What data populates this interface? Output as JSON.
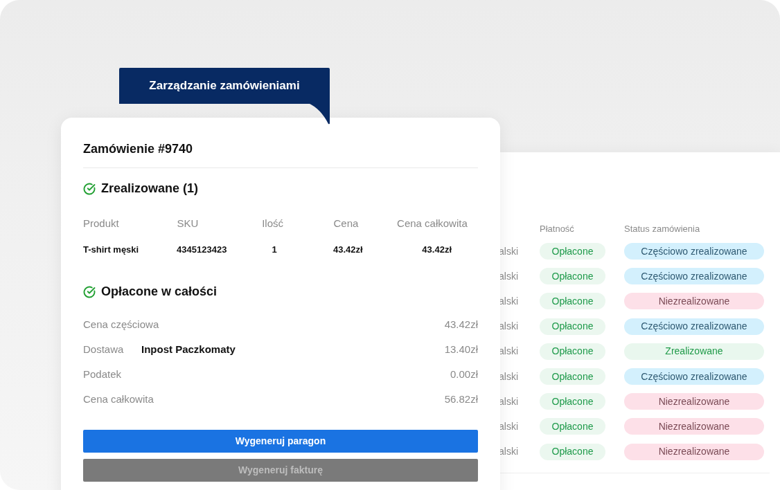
{
  "banner": {
    "title": "Zarządzanie zamówieniami"
  },
  "order": {
    "title": "Zamówienie #9740",
    "fulfilled_heading": "Zrealizowane (1)",
    "items": {
      "columns": [
        "Produkt",
        "SKU",
        "Ilość",
        "Cena",
        "Cena całkowita"
      ],
      "rows": [
        {
          "cells": [
            "T-shirt męski",
            "4345123423",
            "1",
            "43.42zł",
            "43.42zł"
          ]
        }
      ]
    },
    "payment_heading": "Opłacone w całości",
    "summary": [
      {
        "label": "Cena częściowa",
        "value": "43.42zł"
      },
      {
        "label": "Dostawa",
        "detail": "Inpost Paczkomaty",
        "value": "13.40zł"
      },
      {
        "label": "Podatek",
        "value": "0.00zł"
      },
      {
        "label": "Cena całkowita",
        "value": "56.82zł"
      }
    ],
    "buttons": [
      {
        "label": "Wygeneruj paragon",
        "disabled": false
      },
      {
        "label": "Wygeneruj fakturę",
        "disabled": true
      }
    ]
  },
  "orders_table": {
    "columns": [
      "Płatność",
      "Status zamówienia"
    ],
    "rows": [
      {
        "column_1": "alski",
        "payment": "Opłacone",
        "status": {
          "label": "Częściowo zrealizowane",
          "kind": "partial"
        }
      },
      {
        "column_1": "alski",
        "payment": "Opłacone",
        "status": {
          "label": "Częściowo zrealizowane",
          "kind": "partial"
        }
      },
      {
        "column_1": "alski",
        "payment": "Opłacone",
        "status": {
          "label": "Niezrealizowane",
          "kind": "unfulfilled"
        }
      },
      {
        "column_1": "alski",
        "payment": "Opłacone",
        "status": {
          "label": "Częściowo zrealizowane",
          "kind": "partial"
        }
      },
      {
        "column_1": "alski",
        "payment": "Opłacone",
        "status": {
          "label": "Zrealizowane",
          "kind": "fulfilled"
        }
      },
      {
        "column_1": "alski",
        "payment": "Opłacone",
        "status": {
          "label": "Częściowo zrealizowane",
          "kind": "partial"
        }
      },
      {
        "column_1": "alski",
        "payment": "Opłacone",
        "status": {
          "label": "Niezrealizowane",
          "kind": "unfulfilled"
        }
      },
      {
        "column_1": "alski",
        "payment": "Opłacone",
        "status": {
          "label": "Niezrealizowane",
          "kind": "unfulfilled"
        }
      },
      {
        "column_1": "alski",
        "payment": "Opłacone",
        "status": {
          "label": "Niezrealizowane",
          "kind": "unfulfilled"
        }
      }
    ]
  }
}
